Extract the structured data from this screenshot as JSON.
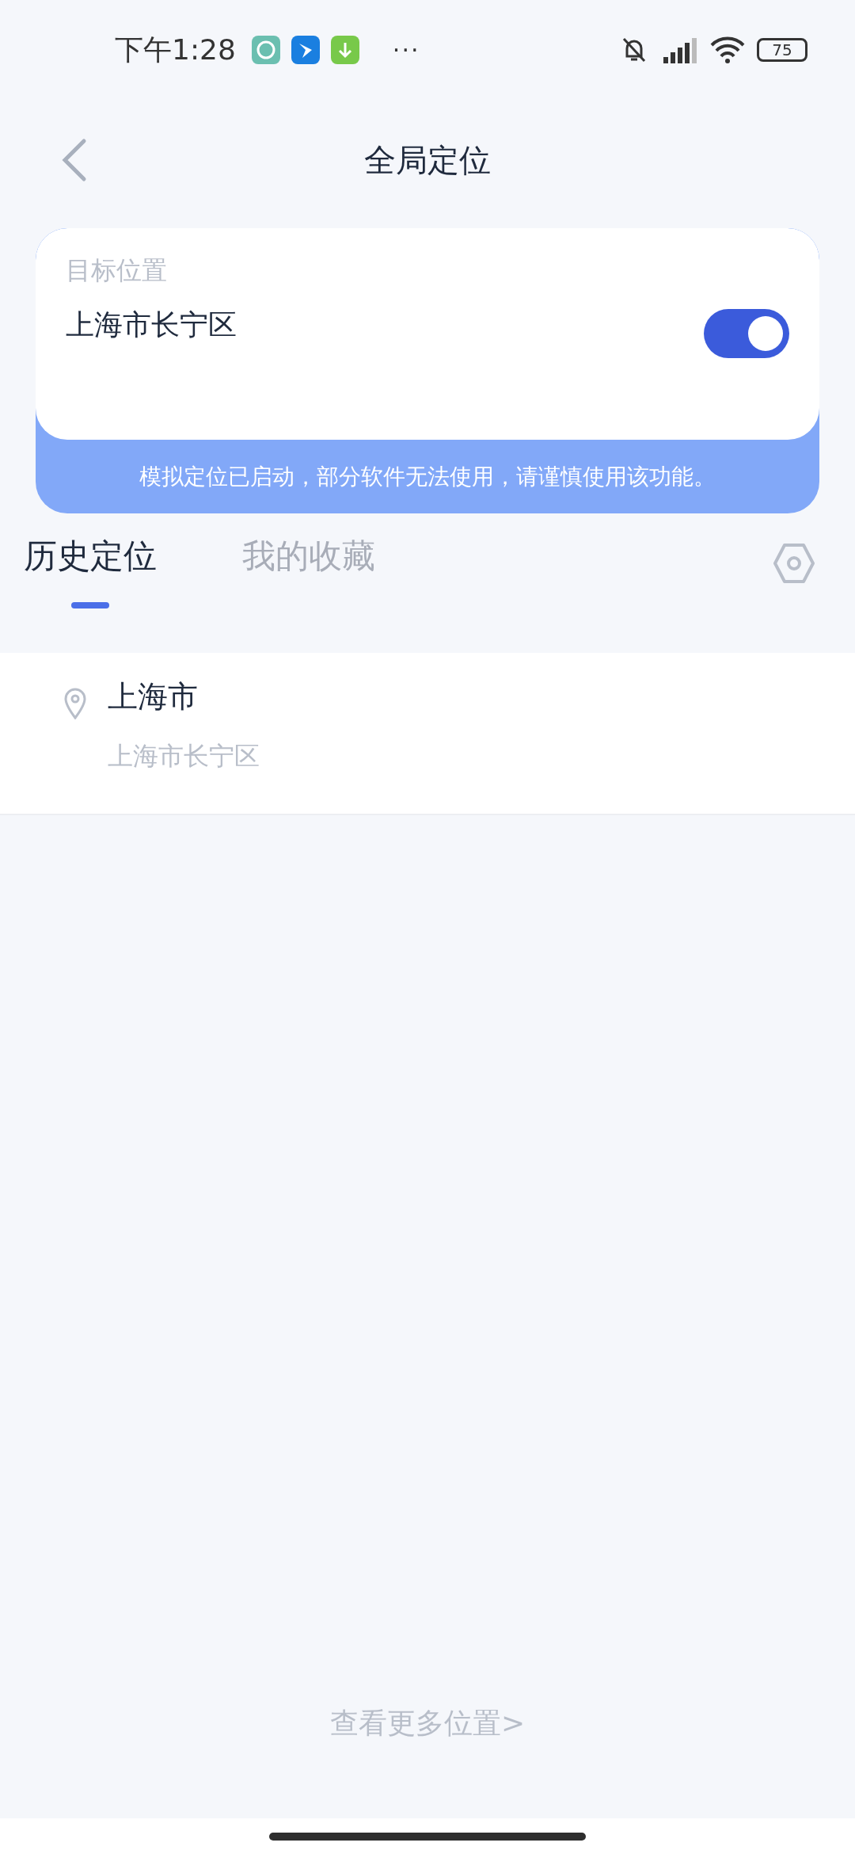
{
  "status_bar": {
    "time": "下午1:28",
    "more": "···",
    "battery": "75"
  },
  "header": {
    "title": "全局定位"
  },
  "target": {
    "label": "目标位置",
    "location": "上海市长宁区",
    "on": true,
    "notice": "模拟定位已启动，部分软件无法使用，请谨慎使用该功能。"
  },
  "tabs": [
    {
      "label": "历史定位",
      "selected": true
    },
    {
      "label": "我的收藏",
      "selected": false
    }
  ],
  "history": [
    {
      "title": "上海市",
      "subtitle": "上海市长宁区"
    }
  ],
  "more_link": "查看更多位置>"
}
